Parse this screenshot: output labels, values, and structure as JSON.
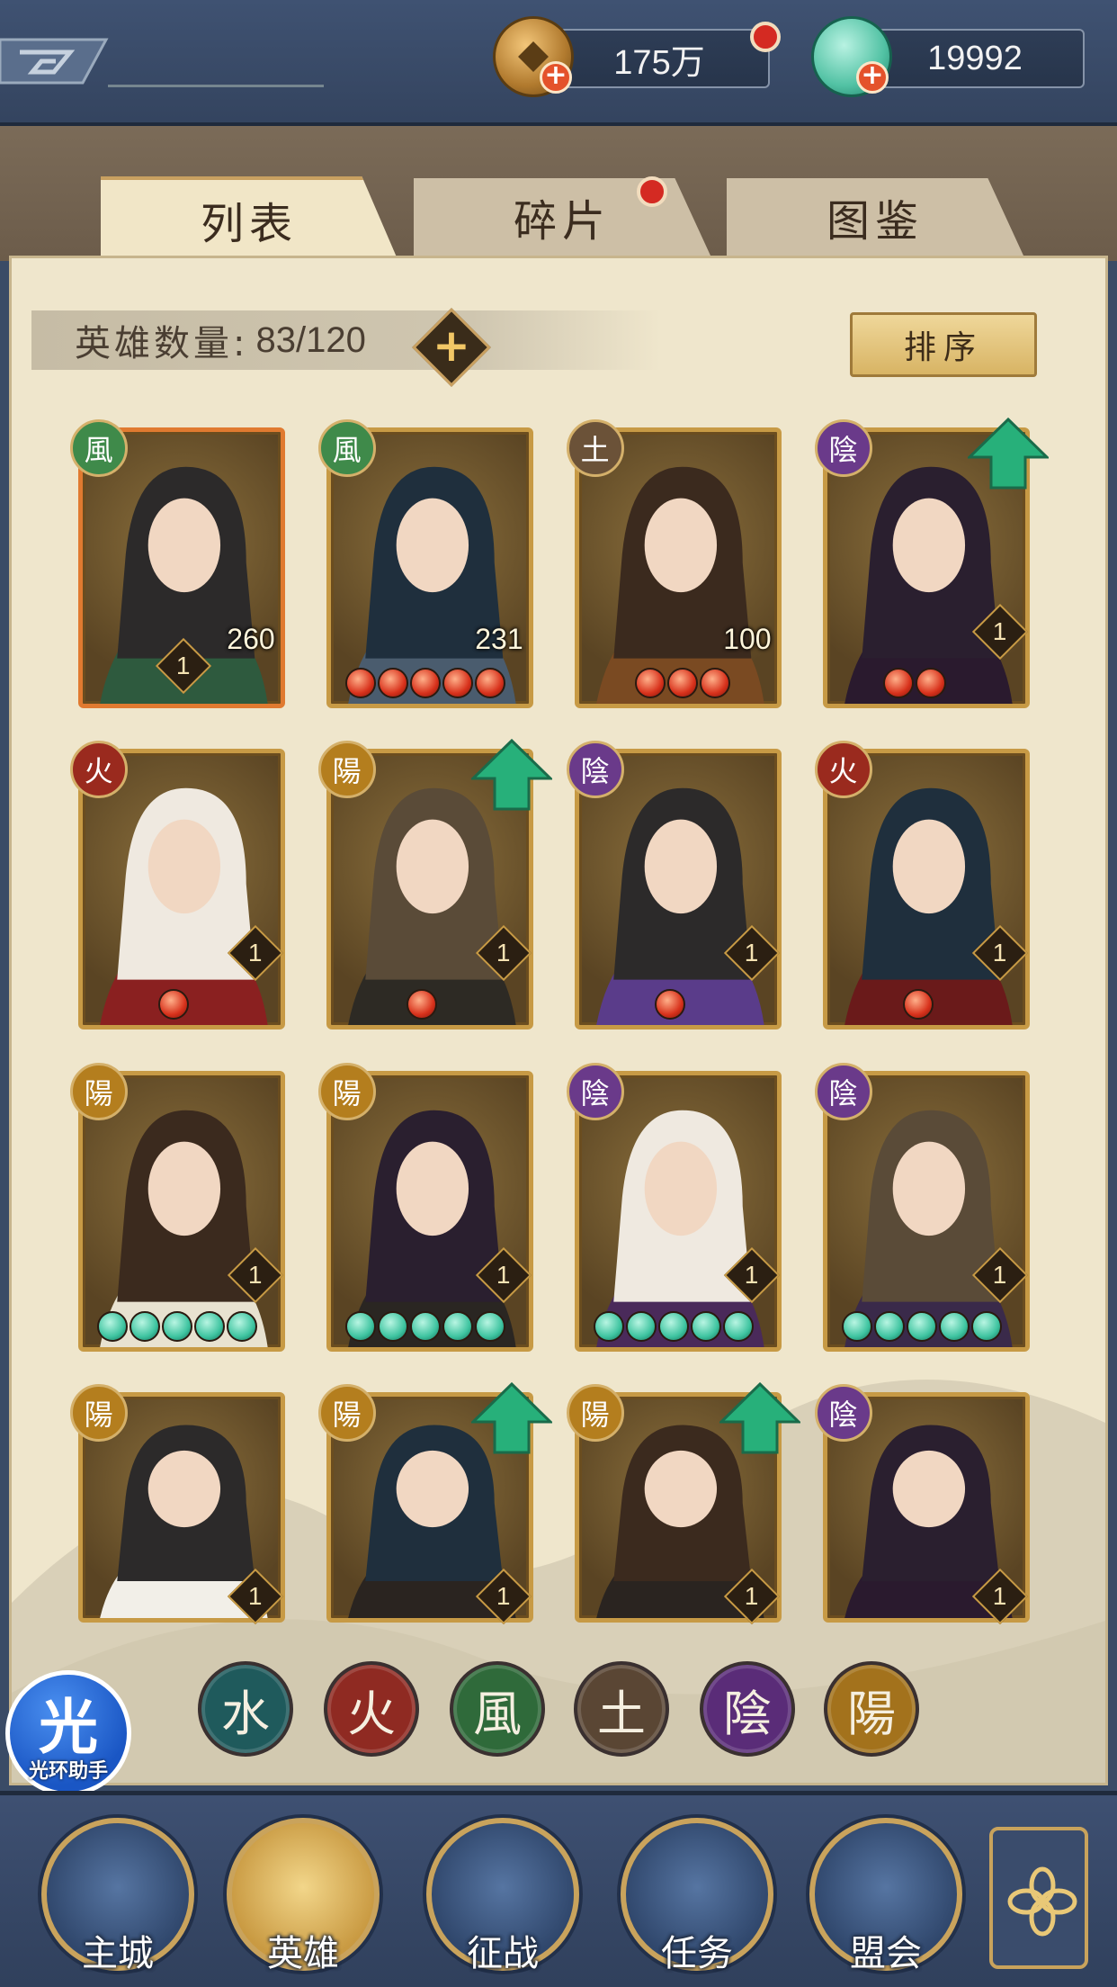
{
  "resources": {
    "coin": {
      "value": "175万",
      "icon": "copper-coin-icon",
      "has_alert": true
    },
    "jade": {
      "value": "19992",
      "icon": "jade-shell-icon"
    }
  },
  "tabs": [
    {
      "label": "列表",
      "active": true
    },
    {
      "label": "碎片",
      "active": false,
      "has_alert": true
    },
    {
      "label": "图鉴",
      "active": false
    }
  ],
  "hero_count": {
    "label": "英雄数量:",
    "value": "83/120"
  },
  "sort_button": "排序",
  "heroes": [
    {
      "element": "風",
      "element_color": "#3f8a4a",
      "level": "1",
      "power": "260",
      "stars": 0,
      "star_color": "red",
      "upgrade": false,
      "frame": "orange"
    },
    {
      "element": "風",
      "element_color": "#3f8a4a",
      "level": "",
      "power": "231",
      "stars": 5,
      "star_color": "red",
      "upgrade": false,
      "frame": "gold"
    },
    {
      "element": "土",
      "element_color": "#6b5238",
      "level": "",
      "power": "100",
      "stars": 3,
      "star_color": "red",
      "upgrade": false,
      "frame": "gold"
    },
    {
      "element": "陰",
      "element_color": "#6a3a8a",
      "level": "1",
      "power": "",
      "stars": 2,
      "star_color": "red",
      "upgrade": true,
      "frame": "gold"
    },
    {
      "element": "火",
      "element_color": "#9a2a1e",
      "level": "1",
      "power": "",
      "stars": 1,
      "star_color": "red",
      "upgrade": false,
      "frame": "gold"
    },
    {
      "element": "陽",
      "element_color": "#b47e1e",
      "level": "1",
      "power": "",
      "stars": 1,
      "star_color": "red",
      "upgrade": true,
      "frame": "gold"
    },
    {
      "element": "陰",
      "element_color": "#6a3a8a",
      "level": "1",
      "power": "",
      "stars": 1,
      "star_color": "red",
      "upgrade": false,
      "frame": "gold"
    },
    {
      "element": "火",
      "element_color": "#9a2a1e",
      "level": "1",
      "power": "",
      "stars": 1,
      "star_color": "red",
      "upgrade": false,
      "frame": "gold"
    },
    {
      "element": "陽",
      "element_color": "#b47e1e",
      "level": "1",
      "power": "",
      "stars": 5,
      "star_color": "green",
      "upgrade": false,
      "frame": "gold"
    },
    {
      "element": "陽",
      "element_color": "#b47e1e",
      "level": "1",
      "power": "",
      "stars": 5,
      "star_color": "green",
      "upgrade": false,
      "frame": "gold"
    },
    {
      "element": "陰",
      "element_color": "#6a3a8a",
      "level": "1",
      "power": "",
      "stars": 5,
      "star_color": "green",
      "upgrade": false,
      "frame": "gold"
    },
    {
      "element": "陰",
      "element_color": "#6a3a8a",
      "level": "1",
      "power": "",
      "stars": 5,
      "star_color": "green",
      "upgrade": false,
      "frame": "gold"
    },
    {
      "element": "陽",
      "element_color": "#b47e1e",
      "level": "1",
      "power": "",
      "stars": 0,
      "star_color": "green",
      "upgrade": false,
      "frame": "gold"
    },
    {
      "element": "陽",
      "element_color": "#b47e1e",
      "level": "1",
      "power": "",
      "stars": 0,
      "star_color": "green",
      "upgrade": true,
      "frame": "gold"
    },
    {
      "element": "陽",
      "element_color": "#b47e1e",
      "level": "1",
      "power": "",
      "stars": 0,
      "star_color": "green",
      "upgrade": true,
      "frame": "gold"
    },
    {
      "element": "陰",
      "element_color": "#6a3a8a",
      "level": "1",
      "power": "",
      "stars": 0,
      "star_color": "green",
      "upgrade": false,
      "frame": "gold"
    }
  ],
  "element_filters": [
    {
      "glyph": "水",
      "color": "#1f5a5c",
      "name": "water"
    },
    {
      "glyph": "火",
      "color": "#8f2a22",
      "name": "fire"
    },
    {
      "glyph": "風",
      "color": "#2f6a3a",
      "name": "wind"
    },
    {
      "glyph": "土",
      "color": "#5a4634",
      "name": "earth"
    },
    {
      "glyph": "陰",
      "color": "#5a2c78",
      "name": "yin"
    },
    {
      "glyph": "陽",
      "color": "#a3721c",
      "name": "yang"
    }
  ],
  "helper": {
    "glyph": "光",
    "label": "光环助手"
  },
  "nav": [
    {
      "label": "主城",
      "icon": "city-gate-icon",
      "active": false
    },
    {
      "label": "英雄",
      "icon": "hero-portrait-icon",
      "active": true
    },
    {
      "label": "征战",
      "icon": "war-horn-icon",
      "active": false
    },
    {
      "label": "任务",
      "icon": "task-scroll-icon",
      "active": false
    },
    {
      "label": "盟会",
      "icon": "alliance-gate-icon",
      "active": false
    }
  ],
  "menu_icon": "flower-menu-icon"
}
